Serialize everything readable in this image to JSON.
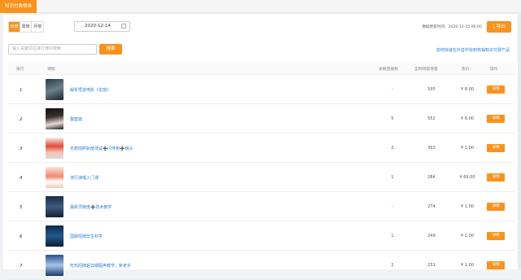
{
  "tab": {
    "label": "知识付费榜单"
  },
  "period": {
    "day": "日榜",
    "week": "周榜",
    "month": "月榜"
  },
  "date": {
    "value": "2020-12-14"
  },
  "update_time": "数据更新时间：2020-12-15 06:00",
  "export_label": "导出",
  "search": {
    "placeholder": "输入关键词在排行榜中搜索",
    "button": "搜索"
  },
  "howto_link": "如何快速在抖音中找到热销知识付费产品",
  "columns": {
    "rank": "排行",
    "course": "课程",
    "live": "关联直播数",
    "sales": "全网销量增量",
    "price": "售价",
    "action": "操作"
  },
  "rows": [
    {
      "rank": "1",
      "name": "解析悟道电影《花瑶》",
      "live": "-",
      "sales": "595",
      "price": "¥ 8.00",
      "detail": "详情"
    },
    {
      "rank": "2",
      "name": "整套篇",
      "live": "5",
      "sales": "552",
      "price": "¥ 8.00",
      "detail": "详情"
    },
    {
      "rank": "3",
      "name": "无痕拍照轨度测试➕闪传枪➕镜头",
      "live": "2",
      "sales": "363",
      "price": "¥ 1.00",
      "detail": "详情"
    },
    {
      "rank": "4",
      "name": "流行演唱入门课",
      "live": "1",
      "sales": "284",
      "price": "¥ 69.00",
      "detail": "详情"
    },
    {
      "rank": "5",
      "name": "最新灵敏度➕技术教学",
      "live": "-",
      "sales": "274",
      "price": "¥ 1.00",
      "detail": "详情"
    },
    {
      "rank": "6",
      "name": "国服招牌华生科学",
      "live": "1",
      "sales": "249",
      "price": "¥ 1.00",
      "detail": "详情"
    },
    {
      "rank": "7",
      "name": "吃鸡招牌超详细图声教学。新老手",
      "live": "2",
      "sales": "231",
      "price": "¥ 1.00",
      "detail": "详情"
    }
  ]
}
